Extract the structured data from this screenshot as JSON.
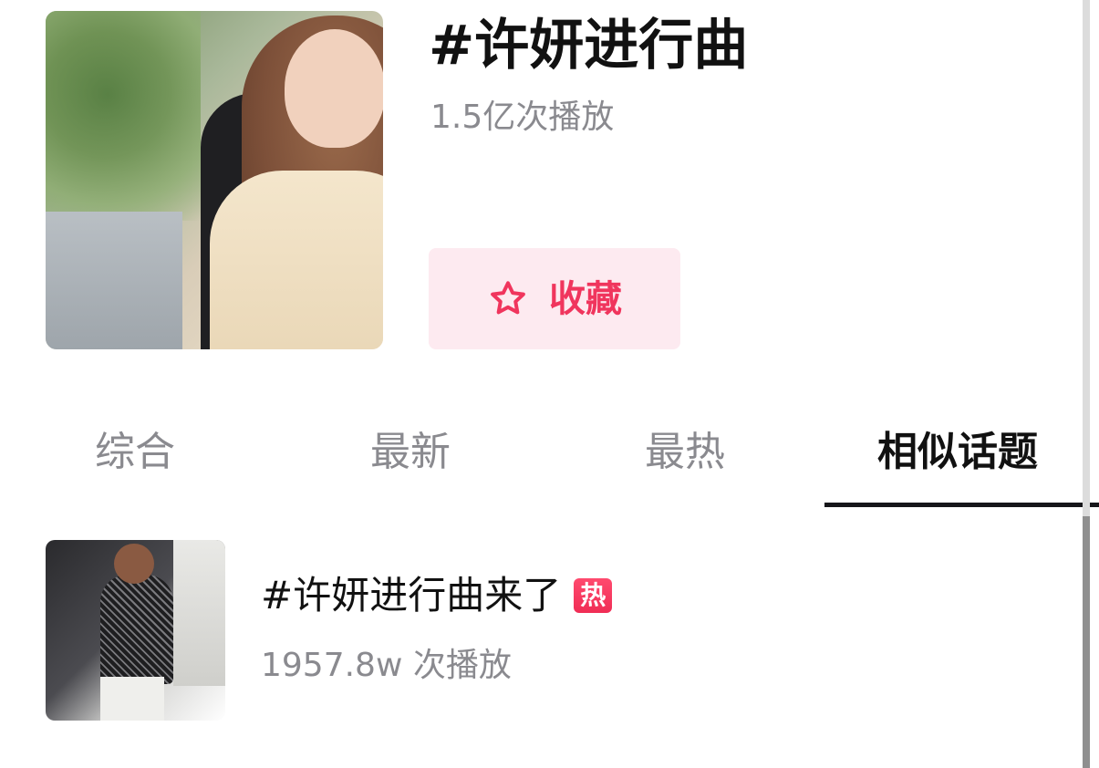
{
  "header": {
    "title": "#许妍进行曲",
    "play_count": "1.5亿次播放",
    "collect_label": "收藏",
    "cover_icon": "topic-cover-image",
    "accent_color": "#f0355d",
    "collect_bg_color": "#fdeaf0"
  },
  "tabs": [
    {
      "label": "综合",
      "active": false
    },
    {
      "label": "最新",
      "active": false
    },
    {
      "label": "最热",
      "active": false
    },
    {
      "label": "相似话题",
      "active": true
    }
  ],
  "related_topics": [
    {
      "title": "#许妍进行曲来了",
      "badge": "热",
      "play_count": "1957.8w 次播放",
      "thumb_icon": "topic-thumbnail-image"
    }
  ],
  "icons": {
    "collect": "star-outline-icon"
  }
}
